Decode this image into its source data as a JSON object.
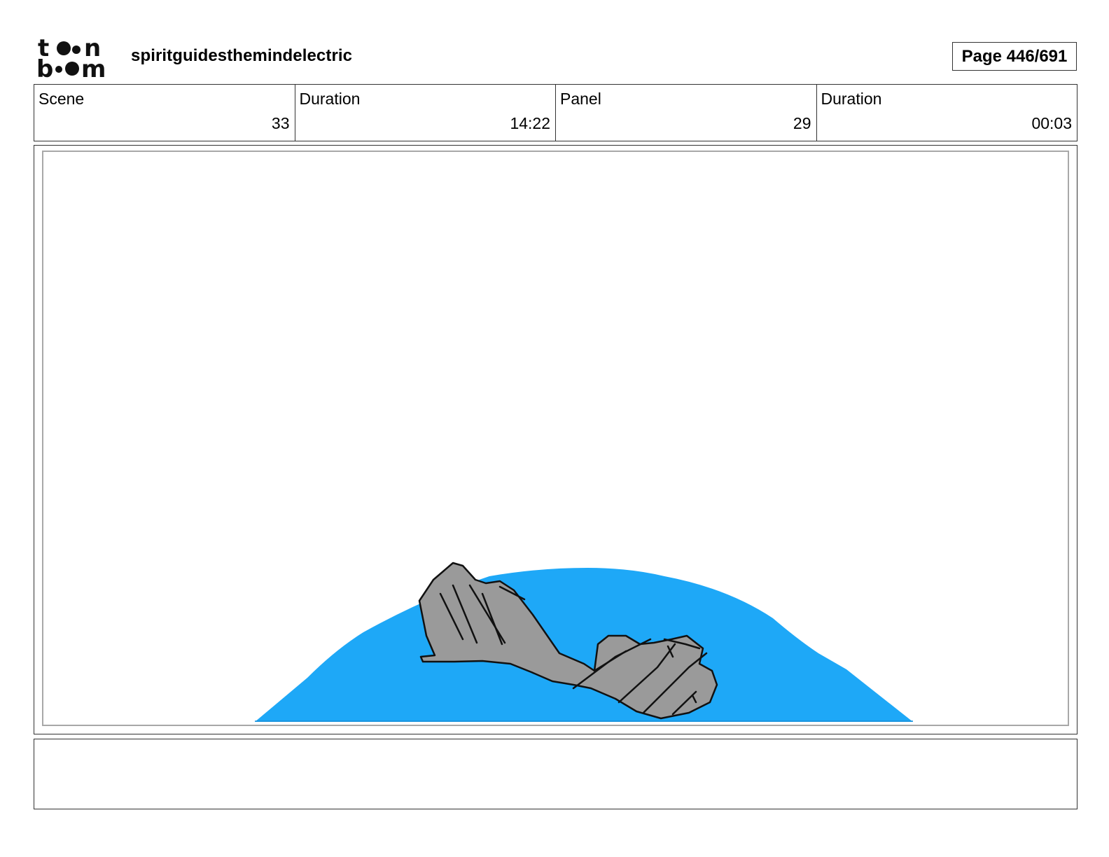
{
  "header": {
    "logo_icon": "toon-boom-logo-icon",
    "project_title": "spiritguidesthemindelectric",
    "page_label": "Page 446/691"
  },
  "info": {
    "scene_label": "Scene",
    "scene_value": "33",
    "scene_duration_label": "Duration",
    "scene_duration_value": "14:22",
    "panel_label": "Panel",
    "panel_value": "29",
    "panel_duration_label": "Duration",
    "panel_duration_value": "00:03"
  },
  "panel": {
    "water_color": "#1ea8f7",
    "rock_color": "#9a9a9a",
    "frame_color": "#a8a8a8"
  },
  "notes": {
    "text": ""
  }
}
